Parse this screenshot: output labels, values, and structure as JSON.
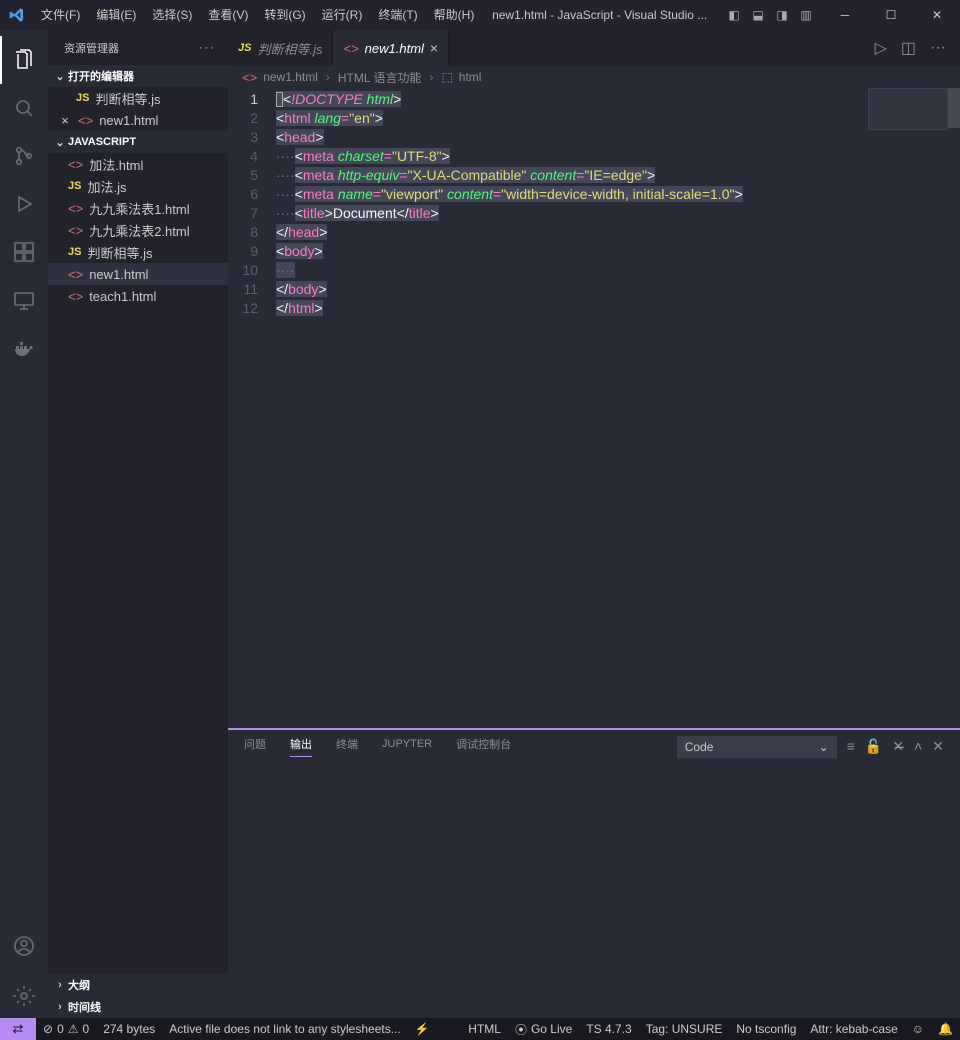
{
  "menu": [
    "文件(F)",
    "编辑(E)",
    "选择(S)",
    "查看(V)",
    "转到(G)",
    "运行(R)",
    "终端(T)",
    "帮助(H)"
  ],
  "window_title": "new1.html - JavaScript - Visual Studio ...",
  "sidebar_header": "资源管理器",
  "open_editors_label": "打开的编辑器",
  "folder_label": "JAVASCRIPT",
  "open_editors": [
    {
      "icon": "js",
      "name": "判断相等.js",
      "close": false
    },
    {
      "icon": "html",
      "name": "new1.html",
      "close": true,
      "sel": false
    }
  ],
  "files": [
    {
      "icon": "html",
      "name": "加法.html"
    },
    {
      "icon": "js",
      "name": "加法.js"
    },
    {
      "icon": "html",
      "name": "九九乘法表1.html"
    },
    {
      "icon": "html",
      "name": "九九乘法表2.html"
    },
    {
      "icon": "js",
      "name": "判断相等.js"
    },
    {
      "icon": "html",
      "name": "new1.html",
      "sel": true
    },
    {
      "icon": "html",
      "name": "teach1.html"
    }
  ],
  "outline_label": "大纲",
  "timeline_label": "时间线",
  "tabs": [
    {
      "icon": "js",
      "name": "判断相等.js",
      "active": false
    },
    {
      "icon": "html",
      "name": "new1.html",
      "active": true
    }
  ],
  "breadcrumb": {
    "file": "new1.html",
    "lang": "HTML 语言功能",
    "node": "html"
  },
  "code_lines": [
    "1",
    "2",
    "3",
    "4",
    "5",
    "6",
    "7",
    "8",
    "9",
    "10",
    "11",
    "12"
  ],
  "panel": {
    "tabs": [
      "问题",
      "输出",
      "终端",
      "JUPYTER",
      "调试控制台"
    ],
    "active": "输出",
    "select": "Code"
  },
  "status": {
    "errors": "0",
    "warnings": "0",
    "bytes": "274 bytes",
    "webhint": "Active file does not link to any stylesheets...",
    "lang": "HTML",
    "golive": "Go Live",
    "ts": "TS 4.7.3",
    "tag": "Tag: UNSURE",
    "tsconfig": "No tsconfig",
    "attr": "Attr: kebab-case"
  }
}
